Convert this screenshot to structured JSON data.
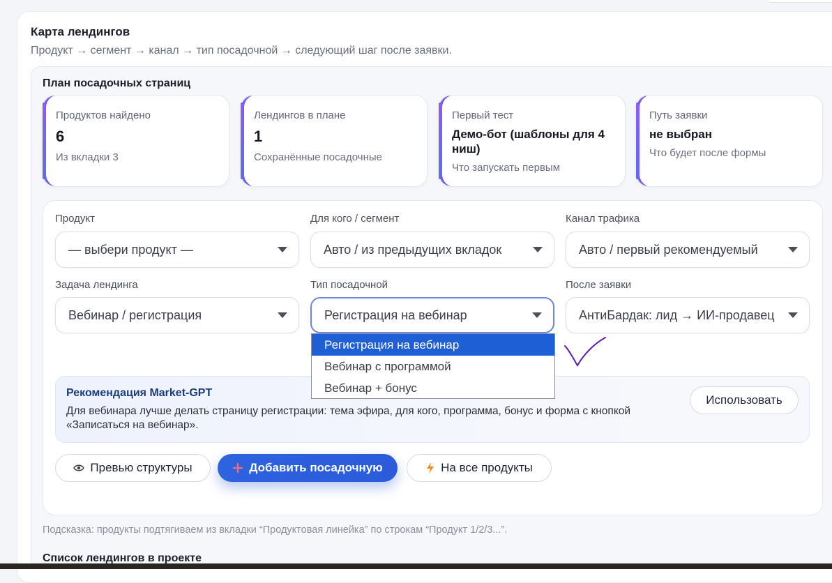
{
  "landing_map": {
    "title": "Карта лендингов",
    "subtitle": "Продукт → сегмент → канал → тип посадочной → следующий шаг после заявки."
  },
  "plan": {
    "title": "План посадочных страниц",
    "stats": [
      {
        "label": "Продуктов найдено",
        "value": "6",
        "note": "Из вкладки 3"
      },
      {
        "label": "Лендингов в плане",
        "value": "1",
        "note": "Сохранённые посадочные"
      },
      {
        "label": "Первый тест",
        "value": "Демо-бот (шаблоны для 4 ниш)",
        "note": "Что запускать первым"
      },
      {
        "label": "Путь заявки",
        "value": "не выбран",
        "note": "Что будет после формы"
      }
    ]
  },
  "form": {
    "product": {
      "label": "Продукт",
      "value": "— выбери продукт —"
    },
    "segment": {
      "label": "Для кого / сегмент",
      "value": "Авто / из предыдущих вкладок"
    },
    "channel": {
      "label": "Канал трафика",
      "value": "Авто / первый рекомендуемый"
    },
    "task": {
      "label": "Задача лендинга",
      "value": "Вебинар / регистрация"
    },
    "type": {
      "label": "Тип посадочной",
      "value": "Регистрация на вебинар",
      "options": [
        "Регистрация на вебинар",
        "Вебинар с программой",
        "Вебинар + бонус"
      ]
    },
    "after": {
      "label": "После заявки",
      "value": "АнтиБардак: лид → ИИ-продавец"
    }
  },
  "recommendation": {
    "title": "Рекомендация Market-GPT",
    "text": "Для вебинара лучше делать страницу регистрации: тема эфира, для кого, программа, бонус и форма с кнопкой «Записаться на вебинар».",
    "use_label": "Использовать"
  },
  "actions": {
    "preview_label": "Превью структуры",
    "add_label": "Добавить посадочную",
    "all_label": "На все продукты"
  },
  "hint": "Подсказка: продукты подтягиваем из вкладки “Продуктовая линейка” по строкам “Продукт 1/2/3...”.",
  "list_title": "Список лендингов в проекте",
  "colors": {
    "accent": "#2b5bd8",
    "stripe": "#7b5cf0",
    "selected": "#1f5fd6"
  }
}
